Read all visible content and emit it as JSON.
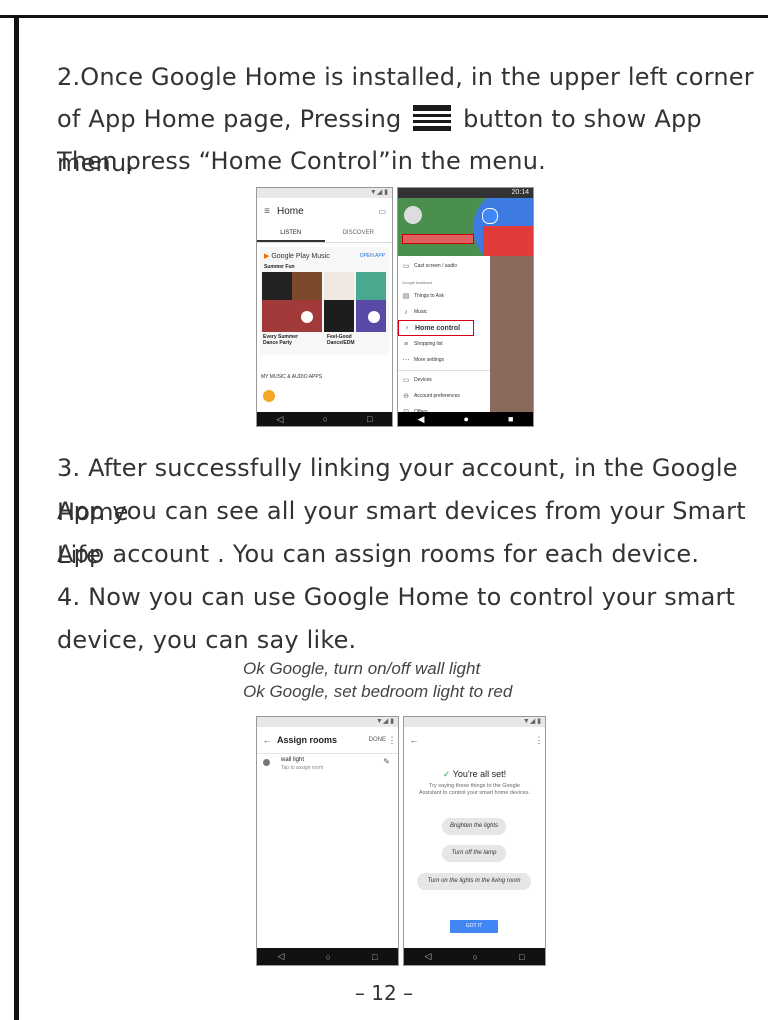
{
  "step2": {
    "line1": "2.Once Google Home is installed, in the upper left corner",
    "line2_before": "of App Home page, Pressing",
    "line2_after": "button to show App menu.",
    "line3": "Then press “Home Control”in the menu.",
    "menu_icon": "hamburger-menu-icon"
  },
  "phone_home": {
    "title": "Home",
    "tab_listen": "LISTEN",
    "tab_discover": "DISCOVER",
    "play_music": "Google Play Music",
    "open_app": "OPEN APP",
    "summer_fun": "Summer Fun",
    "caption_left": "Every Summer Dance Party",
    "caption_right": "Feel-Good Dance/EDM",
    "my_music": "MY MUSIC & AUDIO APPS"
  },
  "phone_menu": {
    "status_time": "20:14",
    "section_label": "Google Assistant",
    "items": [
      {
        "icon": "cast-icon",
        "label": "Cast screen / audio"
      },
      {
        "icon": "things-icon",
        "label": "Things to Ask"
      },
      {
        "icon": "music-icon",
        "label": "Music"
      },
      {
        "icon": "bulb-icon",
        "label": "Home control"
      },
      {
        "icon": "list-icon",
        "label": "Shopping list"
      },
      {
        "icon": "more-icon",
        "label": "More settings"
      },
      {
        "icon": "devices-icon",
        "label": "Devices"
      },
      {
        "icon": "account-icon",
        "label": "Account preferences"
      },
      {
        "icon": "offers-icon",
        "label": "Offers"
      }
    ],
    "highlight_color": "#d0021b"
  },
  "step3": {
    "line1": "3. After successfully linking your account, in the Google Home",
    "line2": "App you can see all your smart devices from your  Smart Life",
    "line3": "App account . You can assign rooms for each device."
  },
  "step4": {
    "line1": "4. Now you can use Google Home to control your smart",
    "line2": "device, you can say like."
  },
  "voice_examples": [
    "Ok Google, turn on/off wall light",
    "Ok Google, set bedroom light to red"
  ],
  "phone_assign": {
    "title": "Assign rooms",
    "done": "DONE",
    "device_name": "wall light",
    "device_sub": "Tap to assign room"
  },
  "phone_allset": {
    "heading": "You're all set!",
    "body": "Try saying these things to the Google Assistant to control your smart home devices.",
    "chips": [
      "Brighten the lights",
      "Turn off the lamp",
      "Turn on the lights in the living room"
    ],
    "button": "GOT IT",
    "accent": "#4285f4",
    "check_color": "#34a853"
  },
  "page_number": "– 12 –"
}
